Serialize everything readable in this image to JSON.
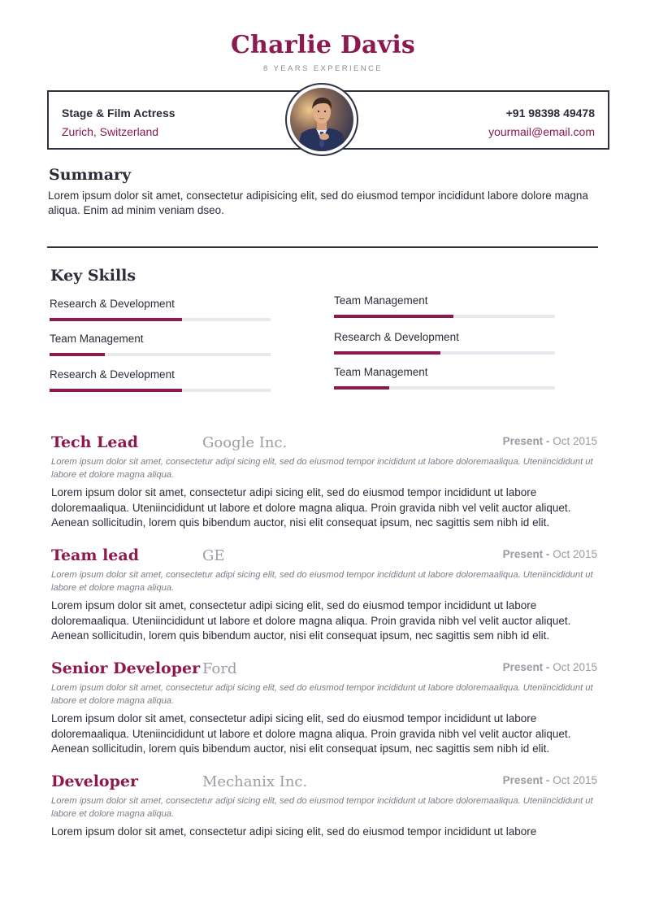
{
  "header": {
    "name": "Charlie Davis",
    "experience": "8 YEARS EXPERIENCE"
  },
  "info": {
    "role": "Stage & Film Actress",
    "location": "Zurich, Switzerland",
    "phone": "+91 98398 49478",
    "email": "yourmail@email.com"
  },
  "summary": {
    "title": "Summary",
    "text": "Lorem ipsum dolor sit amet, consectetur adipisicing elit, sed do eiusmod tempor incididunt labore dolore magna aliqua. Enim ad minim veniam dseo."
  },
  "skills": {
    "title": "Key Skills",
    "items": [
      {
        "label": "Research & Development",
        "level": 0.6
      },
      {
        "label": "Team Management",
        "level": 0.25
      },
      {
        "label": "Research & Development",
        "level": 0.6
      },
      {
        "label": "Team Management",
        "level": 0.54
      },
      {
        "label": "Research & Development",
        "level": 0.48
      },
      {
        "label": "Team Management",
        "level": 0.25
      }
    ]
  },
  "jobs": [
    {
      "title": "Tech Lead",
      "company": "Google Inc.",
      "date_start": "Present -",
      "date_end": "Oct 2015",
      "summary": "Lorem ipsum dolor sit amet, consectetur adipi sicing elit, sed do eiusmod tempor incididunt ut labore doloremaaliqua. Uteniincididunt ut labore et dolore magna aliqua.",
      "description": "Lorem ipsum dolor sit amet, consectetur adipi sicing elit, sed do eiusmod tempor incididunt ut labore doloremaaliqua. Uteniincididunt ut labore et dolore magna aliqua. Proin gravida nibh vel velit auctor aliquet. Aenean sollicitudin, lorem quis bibendum auctor, nisi elit consequat ipsum, nec sagittis sem nibh id elit."
    },
    {
      "title": "Team lead",
      "company": "GE",
      "date_start": "Present -",
      "date_end": "Oct 2015",
      "summary": "Lorem ipsum dolor sit amet, consectetur adipi sicing elit, sed do eiusmod tempor incididunt ut labore doloremaaliqua. Uteniincididunt ut labore et dolore magna aliqua.",
      "description": "Lorem ipsum dolor sit amet, consectetur adipi sicing elit, sed do eiusmod tempor incididunt ut labore doloremaaliqua. Uteniincididunt ut labore et dolore magna aliqua. Proin gravida nibh vel velit auctor aliquet. Aenean sollicitudin, lorem quis bibendum auctor, nisi elit consequat ipsum, nec sagittis sem nibh id elit."
    },
    {
      "title": "Senior Developer",
      "company": "Ford",
      "date_start": "Present -",
      "date_end": "Oct 2015",
      "summary": "Lorem ipsum dolor sit amet, consectetur adipi sicing elit, sed do eiusmod tempor incididunt ut labore doloremaaliqua. Uteniincididunt ut labore et dolore magna aliqua.",
      "description": "Lorem ipsum dolor sit amet, consectetur adipi sicing elit, sed do eiusmod tempor incididunt ut labore doloremaaliqua. Uteniincididunt ut labore et dolore magna aliqua. Proin gravida nibh vel velit auctor aliquet. Aenean sollicitudin, lorem quis bibendum auctor, nisi elit consequat ipsum, nec sagittis sem nibh id elit."
    },
    {
      "title": "Developer",
      "company": "Mechanix Inc.",
      "date_start": "Present -",
      "date_end": "Oct 2015",
      "summary": "Lorem ipsum dolor sit amet, consectetur adipi sicing elit, sed do eiusmod tempor incididunt ut labore doloremaaliqua. Uteniincididunt ut labore et dolore magna aliqua.",
      "description": "Lorem ipsum dolor sit amet, consectetur adipi sicing elit, sed do eiusmod tempor incididunt ut labore"
    }
  ],
  "colors": {
    "accent": "#8c1a4f",
    "dark": "#2f3243",
    "track": "#e8e9ef"
  }
}
